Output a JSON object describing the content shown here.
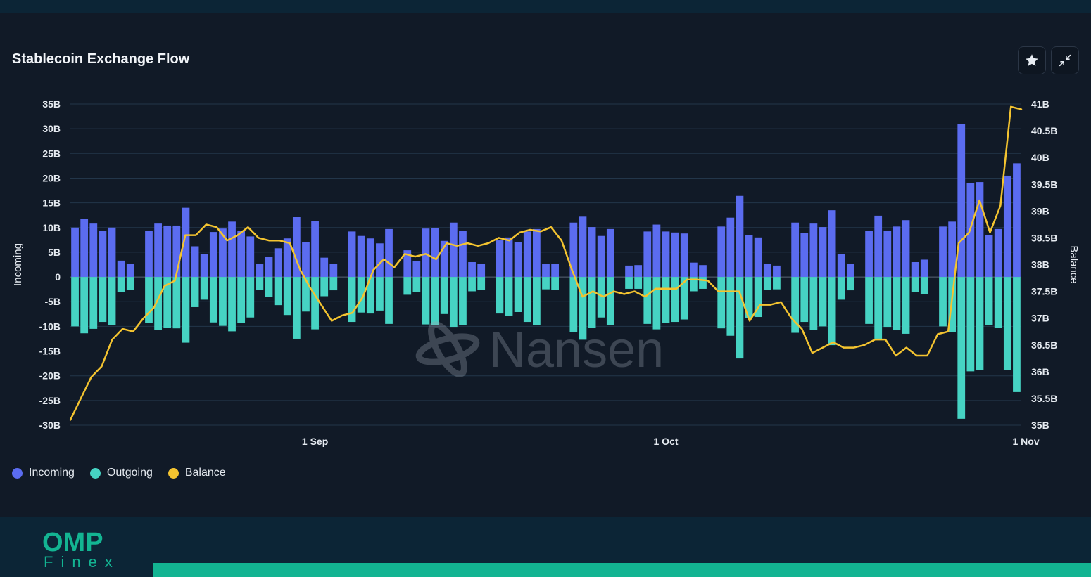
{
  "header": {
    "title": "Stablecoin Exchange Flow",
    "favorite_icon": "star-icon",
    "collapse_icon": "collapse-arrows-icon"
  },
  "watermark": {
    "text": "Nansen",
    "icon": "nansen-logo-icon"
  },
  "branding": {
    "logo_main": "OMP",
    "logo_sub": "Finex"
  },
  "colors": {
    "incoming": "#5b6cf0",
    "outgoing": "#46d3c3",
    "balance": "#f4c430",
    "grid": "#23364a",
    "zero_line": "#5a6676",
    "accent": "#13b492"
  },
  "chart_data": {
    "type": "bar",
    "ylabel": "Incoming",
    "y2label": "Balance",
    "ylim": [
      -30,
      35
    ],
    "y2lim": [
      35,
      41
    ],
    "y_ticks": [
      "35B",
      "30B",
      "25B",
      "20B",
      "15B",
      "10B",
      "5B",
      "0",
      "-5B",
      "-10B",
      "-15B",
      "-20B",
      "-25B",
      "-30B"
    ],
    "y2_ticks": [
      "41B",
      "40.5B",
      "40B",
      "39.5B",
      "39B",
      "38.5B",
      "38B",
      "37.5B",
      "37B",
      "36.5B",
      "36B",
      "35.5B",
      "35B"
    ],
    "x_ticks": [
      {
        "label": "1 Sep",
        "index": 26
      },
      {
        "label": "1 Oct",
        "index": 64
      },
      {
        "label": "1 Nov",
        "index": 103
      }
    ],
    "grid": true,
    "legend_position": "bottom-left",
    "units": "B",
    "series": [
      {
        "name": "Incoming",
        "type": "bar",
        "values": [
          10.0,
          11.8,
          10.8,
          9.3,
          10.0,
          3.3,
          2.6,
          0,
          9.4,
          10.8,
          10.4,
          10.4,
          14.0,
          6.2,
          4.7,
          9.1,
          9.8,
          11.2,
          9.4,
          8.2,
          2.7,
          4.0,
          5.8,
          7.8,
          12.1,
          7.1,
          11.3,
          3.9,
          2.7,
          0,
          9.2,
          8.3,
          7.8,
          6.8,
          9.7,
          0,
          5.4,
          3.2,
          9.8,
          9.9,
          7.3,
          11.0,
          9.4,
          3.0,
          2.6,
          0,
          7.4,
          8.0,
          7.1,
          9.2,
          9.7,
          2.6,
          2.7,
          0,
          11.0,
          12.2,
          10.1,
          8.3,
          9.7,
          0,
          2.3,
          2.4,
          9.2,
          10.6,
          9.2,
          9.0,
          8.8,
          2.9,
          2.4,
          0,
          10.2,
          12.0,
          16.4,
          8.5,
          8.0,
          2.6,
          2.3,
          0,
          11.0,
          8.9,
          10.8,
          10.1,
          13.5,
          4.6,
          2.7,
          0,
          9.3,
          12.4,
          9.4,
          10.2,
          11.5,
          3.0,
          3.5,
          0,
          10.2,
          11.2,
          31.0,
          19.0,
          19.2,
          8.5,
          9.7,
          20.5,
          23.0
        ]
      },
      {
        "name": "Outgoing",
        "type": "bar",
        "values": [
          -10.0,
          -11.4,
          -10.5,
          -9.1,
          -9.8,
          -3.1,
          -2.6,
          0,
          -9.3,
          -10.7,
          -10.3,
          -10.4,
          -13.3,
          -6.1,
          -4.6,
          -9.2,
          -9.9,
          -11.0,
          -9.3,
          -8.2,
          -2.6,
          -4.1,
          -5.7,
          -7.7,
          -12.5,
          -7.0,
          -10.6,
          -3.9,
          -2.7,
          0,
          -9.1,
          -7.2,
          -7.4,
          -6.8,
          -9.5,
          0,
          -3.6,
          -3.0,
          -9.6,
          -9.8,
          -7.5,
          -10.1,
          -9.7,
          -2.9,
          -2.6,
          0,
          -7.4,
          -7.9,
          -7.1,
          -9.1,
          -9.8,
          -2.5,
          -2.6,
          0,
          -11.1,
          -12.7,
          -10.3,
          -8.2,
          -9.8,
          0,
          -2.4,
          -2.4,
          -9.5,
          -10.6,
          -9.3,
          -9.1,
          -8.6,
          -2.9,
          -2.4,
          0,
          -10.4,
          -11.9,
          -16.5,
          -8.3,
          -8.1,
          -2.6,
          -2.5,
          0,
          -11.3,
          -9.1,
          -10.7,
          -10.0,
          -13.8,
          -4.6,
          -2.7,
          0,
          -9.5,
          -12.5,
          -10.1,
          -10.8,
          -11.5,
          -3.0,
          -3.5,
          0,
          -10.0,
          -11.1,
          -28.7,
          -19.1,
          -18.9,
          -9.8,
          -10.3,
          -18.8,
          -23.3
        ]
      },
      {
        "name": "Balance",
        "type": "line",
        "values": [
          35.1,
          35.5,
          35.9,
          36.1,
          36.6,
          36.8,
          36.75,
          37.0,
          37.2,
          37.6,
          37.7,
          38.55,
          38.55,
          38.75,
          38.7,
          38.45,
          38.55,
          38.7,
          38.5,
          38.45,
          38.45,
          38.4,
          37.9,
          37.55,
          37.25,
          36.95,
          37.05,
          37.1,
          37.4,
          37.9,
          38.1,
          37.95,
          38.2,
          38.15,
          38.2,
          38.1,
          38.4,
          38.35,
          38.4,
          38.35,
          38.4,
          38.5,
          38.45,
          38.6,
          38.65,
          38.62,
          38.7,
          38.45,
          37.9,
          37.4,
          37.5,
          37.4,
          37.5,
          37.45,
          37.5,
          37.4,
          37.55,
          37.55,
          37.55,
          37.72,
          37.72,
          37.7,
          37.5,
          37.5,
          37.5,
          36.95,
          37.25,
          37.25,
          37.3,
          37.0,
          36.8,
          36.35,
          36.45,
          36.55,
          36.45,
          36.45,
          36.5,
          36.6,
          36.6,
          36.3,
          36.45,
          36.3,
          36.3,
          36.7,
          36.75,
          38.4,
          38.6,
          39.2,
          38.6,
          39.1,
          40.95,
          40.9
        ]
      }
    ]
  }
}
